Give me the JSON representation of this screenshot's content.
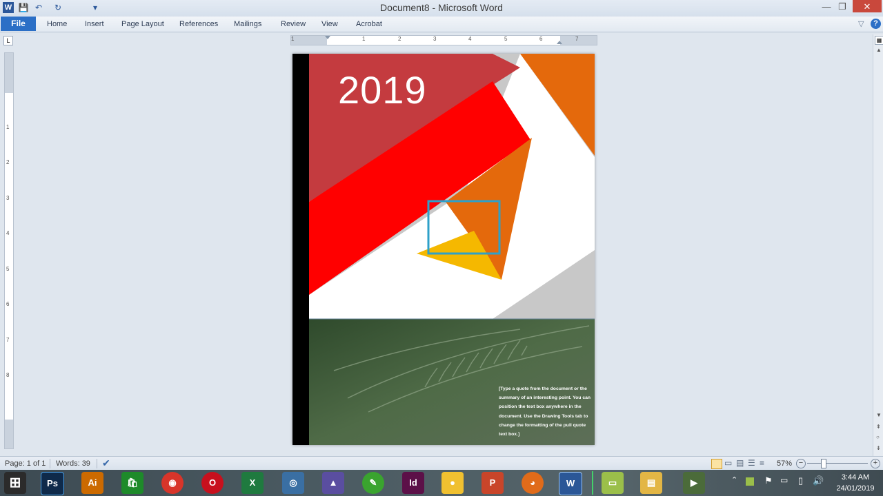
{
  "window": {
    "title": "Document8  -  Microsoft Word",
    "app_icon": "W",
    "minimize": "—",
    "restore": "❐",
    "close": "✕"
  },
  "quick_access": {
    "save_icon": "💾",
    "undo_icon": "↶",
    "redo_icon": "↻",
    "customize_icon": "▾"
  },
  "ribbon": {
    "file_tab": "File",
    "tabs": [
      "Home",
      "Insert",
      "Page Layout",
      "References",
      "Mailings",
      "Review",
      "View",
      "Acrobat"
    ],
    "help_icon": "?",
    "minimize_ribbon_icon": "▽"
  },
  "rulers": {
    "tab_selector": "L",
    "h_numbers": [
      "1",
      "1",
      "2",
      "3",
      "4",
      "5",
      "6",
      "7"
    ],
    "v_numbers": [
      "1",
      "2",
      "3",
      "4",
      "5",
      "6",
      "7",
      "8"
    ]
  },
  "document": {
    "year": "2019",
    "quote": "[Type a quote from the document or the summary of an interesting point. You can position the text box anywhere in the document. Use the Drawing Tools tab to change the formatting of the pull quote text box.]",
    "colors": {
      "sidebar": "#000000",
      "gray": "#c8c8c8",
      "dark_red": "#c43b3f",
      "red": "#ff0000",
      "orange": "#e4690c",
      "yellow": "#f5b800",
      "selection": "#2ea0c9",
      "photo_green": "#3f5a3c"
    }
  },
  "status": {
    "page": "Page: 1 of 1",
    "words": "Words: 39",
    "zoom": "57%",
    "zoom_out": "−",
    "zoom_in": "+"
  },
  "taskbar": {
    "apps": [
      {
        "name": "start",
        "label": "⊞",
        "color": "#2b2b2b"
      },
      {
        "name": "photoshop",
        "label": "Ps",
        "color": "#0f2a4a"
      },
      {
        "name": "illustrator",
        "label": "Ai",
        "color": "#cc6a00"
      },
      {
        "name": "store",
        "label": "🛍",
        "color": "#1e8a2a"
      },
      {
        "name": "chrome",
        "label": "◉",
        "color": "#d8352a"
      },
      {
        "name": "opera",
        "label": "O",
        "color": "#c8101d"
      },
      {
        "name": "excel",
        "label": "X",
        "color": "#1f7a3f"
      },
      {
        "name": "camera",
        "label": "◎",
        "color": "#3a6fa3"
      },
      {
        "name": "photos",
        "label": "▲",
        "color": "#5a4ea0"
      },
      {
        "name": "greenshot",
        "label": "✎",
        "color": "#3aa42f"
      },
      {
        "name": "indesign",
        "label": "Id",
        "color": "#5c1048"
      },
      {
        "name": "messenger",
        "label": "●",
        "color": "#f0c030"
      },
      {
        "name": "powerpoint",
        "label": "P",
        "color": "#c9452a"
      },
      {
        "name": "firefox",
        "label": "◕",
        "color": "#e06b1a"
      },
      {
        "name": "word",
        "label": "W",
        "color": "#2b5797"
      },
      {
        "name": "notes",
        "label": "▭",
        "color": "#9bbf4a"
      },
      {
        "name": "explorer",
        "label": "▤",
        "color": "#e3b645"
      },
      {
        "name": "video",
        "label": "▶",
        "color": "#4b6b3a"
      }
    ],
    "time": "3:44 AM",
    "date": "24/01/2019"
  }
}
